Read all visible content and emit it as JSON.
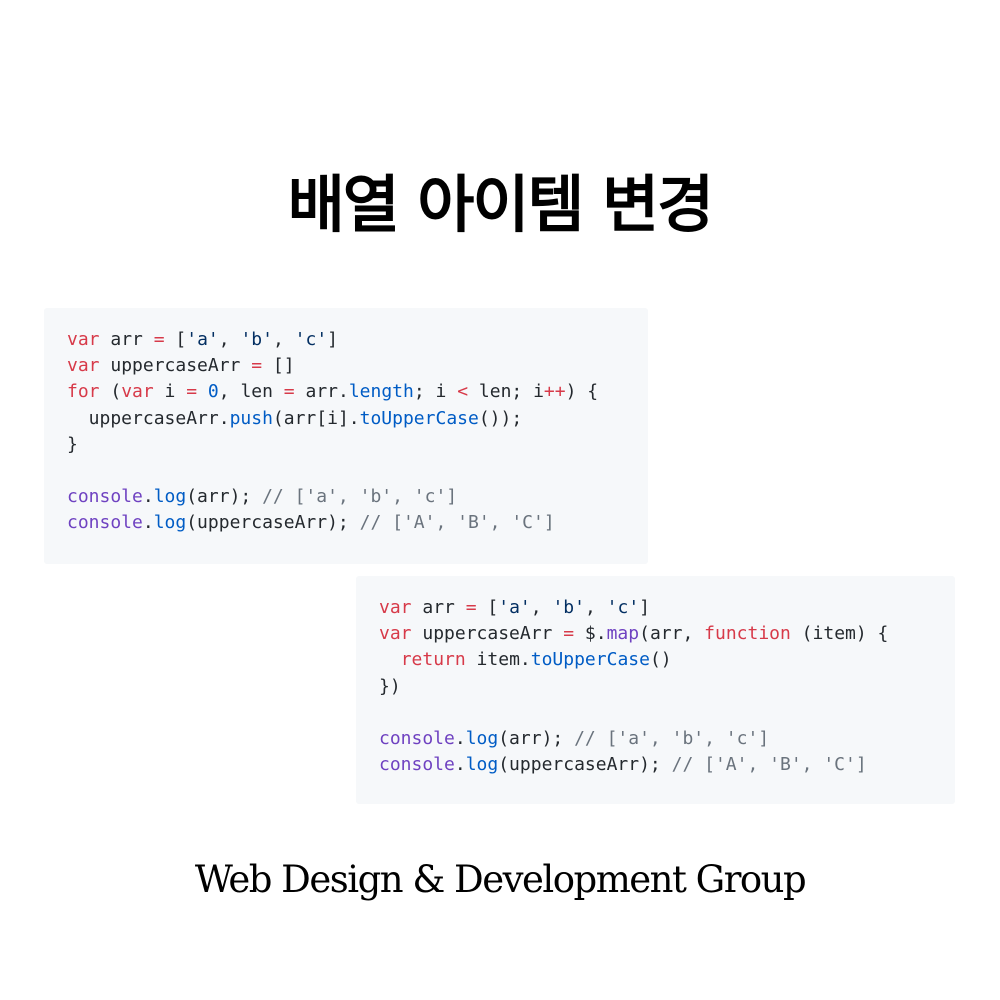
{
  "page": {
    "title": "배열 아이템 변경",
    "footer": "Web Design & Development Group"
  },
  "colors": {
    "keyword": "#d73a49",
    "function": "#6f42c1",
    "property": "#005cc5",
    "string": "#032f62",
    "comment": "#6a737d",
    "plain": "#24292e",
    "code_background": "#f6f8fa"
  },
  "code_blocks": [
    {
      "language": "javascript",
      "lines": [
        [
          [
            "keyword",
            "var"
          ],
          [
            "plain",
            " arr "
          ],
          [
            "keyword",
            "="
          ],
          [
            "plain",
            " ["
          ],
          [
            "string",
            "'a'"
          ],
          [
            "plain",
            ", "
          ],
          [
            "string",
            "'b'"
          ],
          [
            "plain",
            ", "
          ],
          [
            "string",
            "'c'"
          ],
          [
            "plain",
            "]"
          ]
        ],
        [
          [
            "keyword",
            "var"
          ],
          [
            "plain",
            " uppercaseArr "
          ],
          [
            "keyword",
            "="
          ],
          [
            "plain",
            " []"
          ]
        ],
        [
          [
            "keyword",
            "for"
          ],
          [
            "plain",
            " ("
          ],
          [
            "keyword",
            "var"
          ],
          [
            "plain",
            " i "
          ],
          [
            "keyword",
            "="
          ],
          [
            "plain",
            " "
          ],
          [
            "number",
            "0"
          ],
          [
            "plain",
            ", len "
          ],
          [
            "keyword",
            "="
          ],
          [
            "plain",
            " arr."
          ],
          [
            "prop",
            "length"
          ],
          [
            "plain",
            "; i "
          ],
          [
            "keyword",
            "<"
          ],
          [
            "plain",
            " len; i"
          ],
          [
            "keyword",
            "++"
          ],
          [
            "plain",
            ") {"
          ]
        ],
        [
          [
            "plain",
            "  uppercaseArr."
          ],
          [
            "prop",
            "push"
          ],
          [
            "plain",
            "(arr[i]."
          ],
          [
            "prop",
            "toUpperCase"
          ],
          [
            "plain",
            "());"
          ]
        ],
        [
          [
            "plain",
            "}"
          ]
        ],
        [],
        [
          [
            "func",
            "console"
          ],
          [
            "plain",
            "."
          ],
          [
            "prop",
            "log"
          ],
          [
            "plain",
            "(arr); "
          ],
          [
            "comment",
            "// ['a', 'b', 'c']"
          ]
        ],
        [
          [
            "func",
            "console"
          ],
          [
            "plain",
            "."
          ],
          [
            "prop",
            "log"
          ],
          [
            "plain",
            "(uppercaseArr); "
          ],
          [
            "comment",
            "// ['A', 'B', 'C']"
          ]
        ]
      ]
    },
    {
      "language": "javascript",
      "lines": [
        [
          [
            "keyword",
            "var"
          ],
          [
            "plain",
            " arr "
          ],
          [
            "keyword",
            "="
          ],
          [
            "plain",
            " ["
          ],
          [
            "string",
            "'a'"
          ],
          [
            "plain",
            ", "
          ],
          [
            "string",
            "'b'"
          ],
          [
            "plain",
            ", "
          ],
          [
            "string",
            "'c'"
          ],
          [
            "plain",
            "]"
          ]
        ],
        [
          [
            "keyword",
            "var"
          ],
          [
            "plain",
            " uppercaseArr "
          ],
          [
            "keyword",
            "="
          ],
          [
            "plain",
            " $."
          ],
          [
            "func",
            "map"
          ],
          [
            "plain",
            "(arr, "
          ],
          [
            "keyword",
            "function"
          ],
          [
            "plain",
            " (item) {"
          ]
        ],
        [
          [
            "plain",
            "  "
          ],
          [
            "keyword",
            "return"
          ],
          [
            "plain",
            " item."
          ],
          [
            "prop",
            "toUpperCase"
          ],
          [
            "plain",
            "()"
          ]
        ],
        [
          [
            "plain",
            "})"
          ]
        ],
        [],
        [
          [
            "func",
            "console"
          ],
          [
            "plain",
            "."
          ],
          [
            "prop",
            "log"
          ],
          [
            "plain",
            "(arr); "
          ],
          [
            "comment",
            "// ['a', 'b', 'c']"
          ]
        ],
        [
          [
            "func",
            "console"
          ],
          [
            "plain",
            "."
          ],
          [
            "prop",
            "log"
          ],
          [
            "plain",
            "(uppercaseArr); "
          ],
          [
            "comment",
            "// ['A', 'B', 'C']"
          ]
        ]
      ]
    }
  ]
}
